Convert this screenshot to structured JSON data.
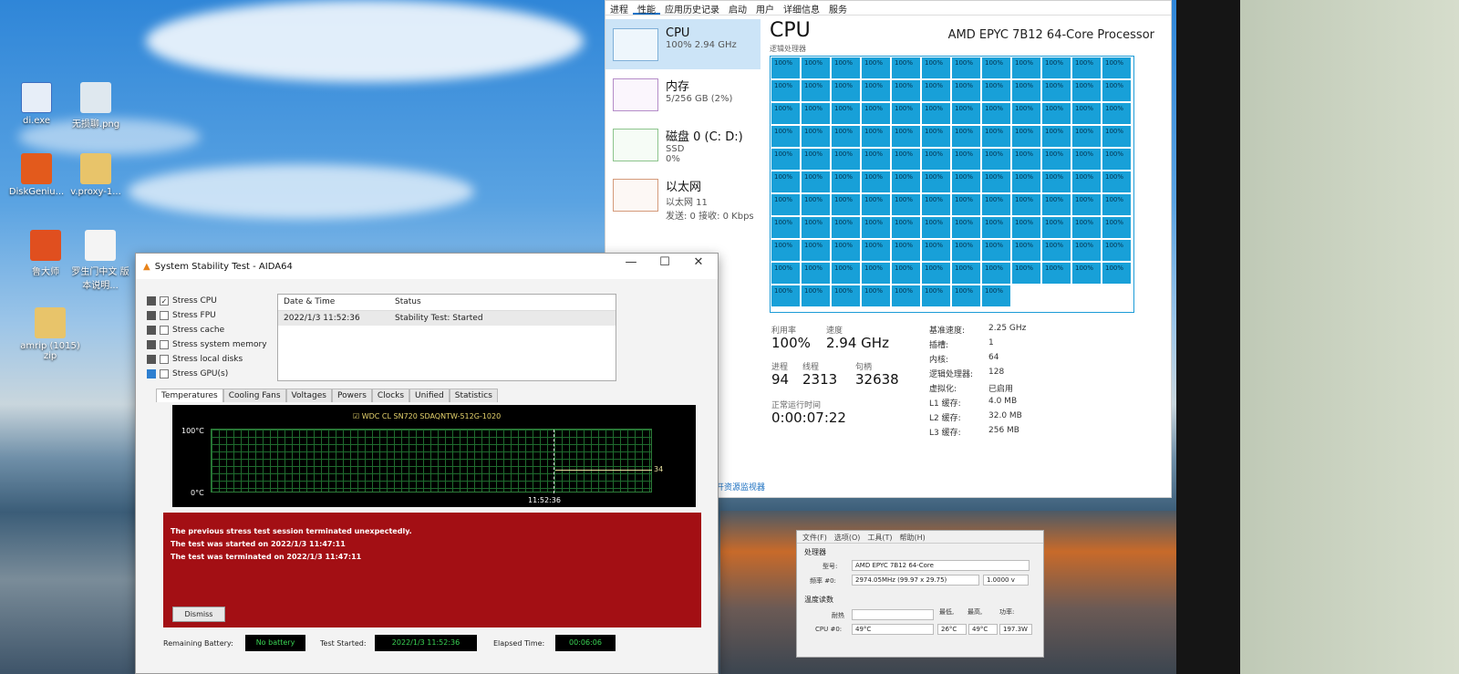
{
  "desktop": {
    "icons": [
      {
        "label": "di.exe"
      },
      {
        "label": "无损聊.png"
      },
      {
        "label": "DiskGeniu..."
      },
      {
        "label": "v.proxy-1..."
      },
      {
        "label": "鲁大师"
      },
      {
        "label": "罗生门中文 版本说明..."
      },
      {
        "label": "amrip (1015) zip"
      }
    ]
  },
  "taskmgr": {
    "tabs": [
      "进程",
      "性能",
      "应用历史记录",
      "启动",
      "用户",
      "详细信息",
      "服务"
    ],
    "sidebar": [
      {
        "name": "CPU",
        "line1": "100% 2.94 GHz",
        "line2": ""
      },
      {
        "name": "内存",
        "line1": "5/256 GB (2%)",
        "line2": ""
      },
      {
        "name": "磁盘 0 (C: D:)",
        "line1": "SSD",
        "line2": "0%"
      },
      {
        "name": "以太网",
        "line1": "以太网 11",
        "line2": "发送: 0 接收: 0 Kbps"
      }
    ],
    "title": "CPU",
    "processor": "AMD EPYC 7B12 64-Core Processor",
    "grid_label": "逻辑处理器",
    "core_value": "100%",
    "core_count": 128,
    "utilization_label": "利用率",
    "utilization": "100%",
    "speed_label": "速度",
    "speed": "2.94 GHz",
    "processes_label": "进程",
    "processes": "94",
    "threads_label": "线程",
    "threads": "2313",
    "handles_label": "句柄",
    "handles": "32638",
    "uptime_label": "正常运行时间",
    "uptime": "0:00:07:22",
    "details": [
      {
        "k": "基准速度:",
        "v": "2.25 GHz"
      },
      {
        "k": "插槽:",
        "v": "1"
      },
      {
        "k": "内核:",
        "v": "64"
      },
      {
        "k": "逻辑处理器:",
        "v": "128"
      },
      {
        "k": "虚拟化:",
        "v": "已启用"
      },
      {
        "k": "L1 缓存:",
        "v": "4.0 MB"
      },
      {
        "k": "L2 缓存:",
        "v": "32.0 MB"
      },
      {
        "k": "L3 缓存:",
        "v": "256 MB"
      }
    ],
    "monitor_link": "打开资源监视器"
  },
  "aida": {
    "title": "System Stability Test - AIDA64",
    "stress": [
      {
        "label": "Stress CPU",
        "checked": true
      },
      {
        "label": "Stress FPU",
        "checked": false
      },
      {
        "label": "Stress cache",
        "checked": false
      },
      {
        "label": "Stress system memory",
        "checked": false
      },
      {
        "label": "Stress local disks",
        "checked": false
      },
      {
        "label": "Stress GPU(s)",
        "checked": false
      }
    ],
    "log_headers": [
      "Date & Time",
      "Status"
    ],
    "log_rows": [
      {
        "time": "2022/1/3 11:52:36",
        "status": "Stability Test: Started"
      }
    ],
    "tabs": [
      "Temperatures",
      "Cooling Fans",
      "Voltages",
      "Powers",
      "Clocks",
      "Unified",
      "Statistics"
    ],
    "graph": {
      "device": "WDC CL SN720 SDAQNTW-512G-1020",
      "y_top": "100°C",
      "y_bottom": "0°C",
      "x_label": "11:52:36",
      "current": "34"
    },
    "alert_lines": [
      "The previous stress test session terminated unexpectedly.",
      "The test was started on 2022/1/3 11:47:11",
      "The test was terminated on 2022/1/3 11:47:11"
    ],
    "dismiss": "Dismiss",
    "remaining_battery_label": "Remaining Battery:",
    "remaining_battery": "No battery",
    "test_started_label": "Test Started:",
    "test_started": "2022/1/3 11:52:36",
    "elapsed_label": "Elapsed Time:",
    "elapsed": "00:06:06"
  },
  "cpuid": {
    "menu": [
      "文件(F)",
      "选项(O)",
      "工具(T)",
      "帮助(H)"
    ],
    "processor_section": "处理器",
    "model_label": "型号:",
    "model": "AMD EPYC 7B12 64-Core",
    "freq_label": "频率 #0:",
    "freq": "2974.05MHz (99.97 x 29.75)",
    "voltage": "1.0000 v",
    "temp_section": "温度读数",
    "heat_label": "耐热",
    "min_label": "最低,",
    "max_label": "最高,",
    "power_label": "功率:",
    "cpu_label": "CPU #0:",
    "cpu_temp": "49°C",
    "min": "26°C",
    "max": "49°C",
    "power": "197.3W"
  }
}
